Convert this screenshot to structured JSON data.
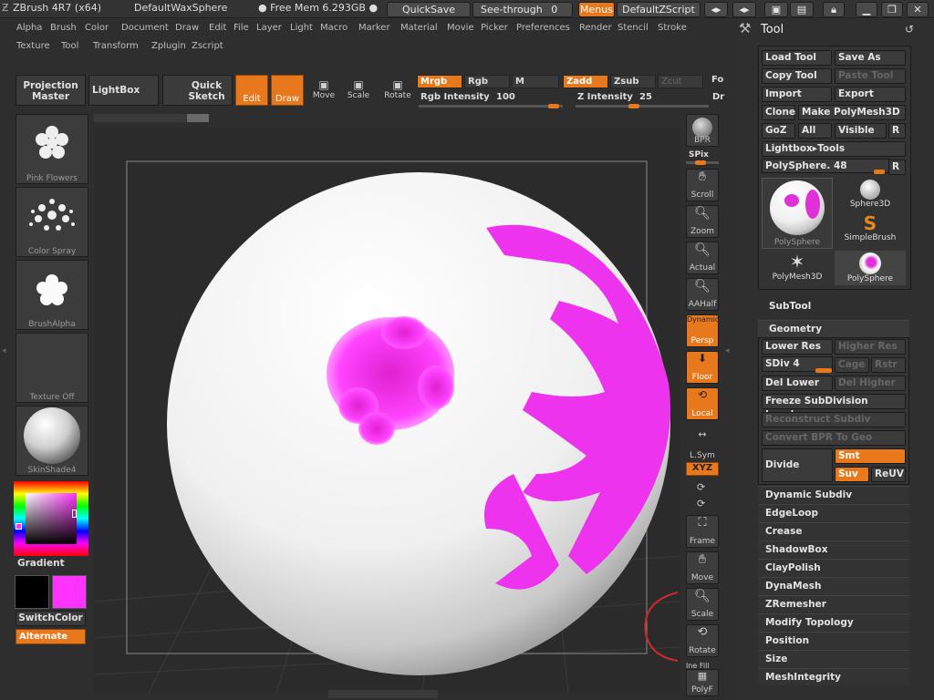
{
  "app": {
    "title": "ZBrush 4R7 (x64)",
    "doc": "DefaultWaxSphere",
    "mem": "● Free Mem 6.293GB ●",
    "quicksave": "QuickSave",
    "seethrough": "See-through",
    "seethrough_value": "0",
    "menus": "Menus",
    "script": "DefaultZScript"
  },
  "menus": {
    "row1": [
      "Alpha",
      "Brush",
      "Color",
      "Document",
      "Draw",
      "Edit",
      "File",
      "Layer",
      "Light",
      "Macro",
      "Marker",
      "Material",
      "Movie",
      "Picker",
      "Preferences",
      "Render",
      "Stencil",
      "Stroke"
    ],
    "row2": [
      "Texture",
      "Tool",
      "Transform",
      "Zplugin",
      "Zscript"
    ]
  },
  "toolbar": {
    "projection": "Projection Master",
    "lightbox": "LightBox",
    "quicksketch": "Quick Sketch",
    "edit": "Edit",
    "draw": "Draw",
    "move": "Move",
    "scale": "Scale",
    "rotate": "Rotate",
    "mrgb": "Mrgb",
    "rgb": "Rgb",
    "m": "M",
    "zadd": "Zadd",
    "zsub": "Zsub",
    "zcut": "Zcut",
    "rgb_intensity_label": "Rgb Intensity",
    "rgb_intensity": "100",
    "z_intensity_label": "Z Intensity",
    "z_intensity": "25",
    "fo": "Fo",
    "dr": "Dr"
  },
  "left": {
    "thumbs": [
      "Pink Flowers",
      "Color Spray",
      "BrushAlpha",
      "Texture Off",
      "SkinShade4"
    ],
    "gradient": "Gradient",
    "switchcolor": "SwitchColor",
    "alternate": "Alternate",
    "colors": {
      "main": "#000000",
      "secondary": "#ff33ff"
    }
  },
  "right": {
    "bpr": "BPR",
    "spix": "SPix",
    "scroll": "Scroll",
    "zoom": "Zoom",
    "actual": "Actual",
    "aahalf": "AAHalf",
    "dynamic": "Dynamic",
    "persp": "Persp",
    "floor": "Floor",
    "local": "Local",
    "lsym": "L.Sym",
    "xyz": "XYZ",
    "frame": "Frame",
    "move": "Move",
    "scale": "Scale",
    "rotate": "Rotate",
    "linefill": "Ine Fill",
    "polyf": "PolyF"
  },
  "tool": {
    "title": "Tool",
    "load": "Load Tool",
    "saveas": "Save As",
    "copy": "Copy Tool",
    "paste": "Paste Tool",
    "import": "Import",
    "export": "Export",
    "clone": "Clone",
    "makepm": "Make PolyMesh3D",
    "goz": "GoZ",
    "all": "All",
    "visible": "Visible",
    "r": "R",
    "lightboxtools": "Lightbox▸Tools",
    "polysphere": "PolySphere. 48",
    "tiles": [
      "PolySphere",
      "Sphere3D",
      "SimpleBrush",
      "PolyMesh3D",
      "PolySphere"
    ],
    "subtool": "SubTool",
    "geometry": "Geometry",
    "lowerres": "Lower Res",
    "higherres": "Higher Res",
    "sdiv": "SDiv 4",
    "cage": "Cage",
    "rstr": "Rstr",
    "dellower": "Del Lower",
    "delhigher": "Del Higher",
    "freeze": "Freeze SubDivision Levels",
    "reconstruct": "Reconstruct Subdiv",
    "convert": "Convert BPR To Geo",
    "divide": "Divide",
    "smt": "Smt",
    "suv": "Suv",
    "reuv": "ReUV",
    "sections": [
      "Dynamic Subdiv",
      "EdgeLoop",
      "Crease",
      "ShadowBox",
      "ClayPolish",
      "DynaMesh",
      "ZRemesher",
      "Modify Topology",
      "Position",
      "Size",
      "MeshIntegrity"
    ]
  }
}
